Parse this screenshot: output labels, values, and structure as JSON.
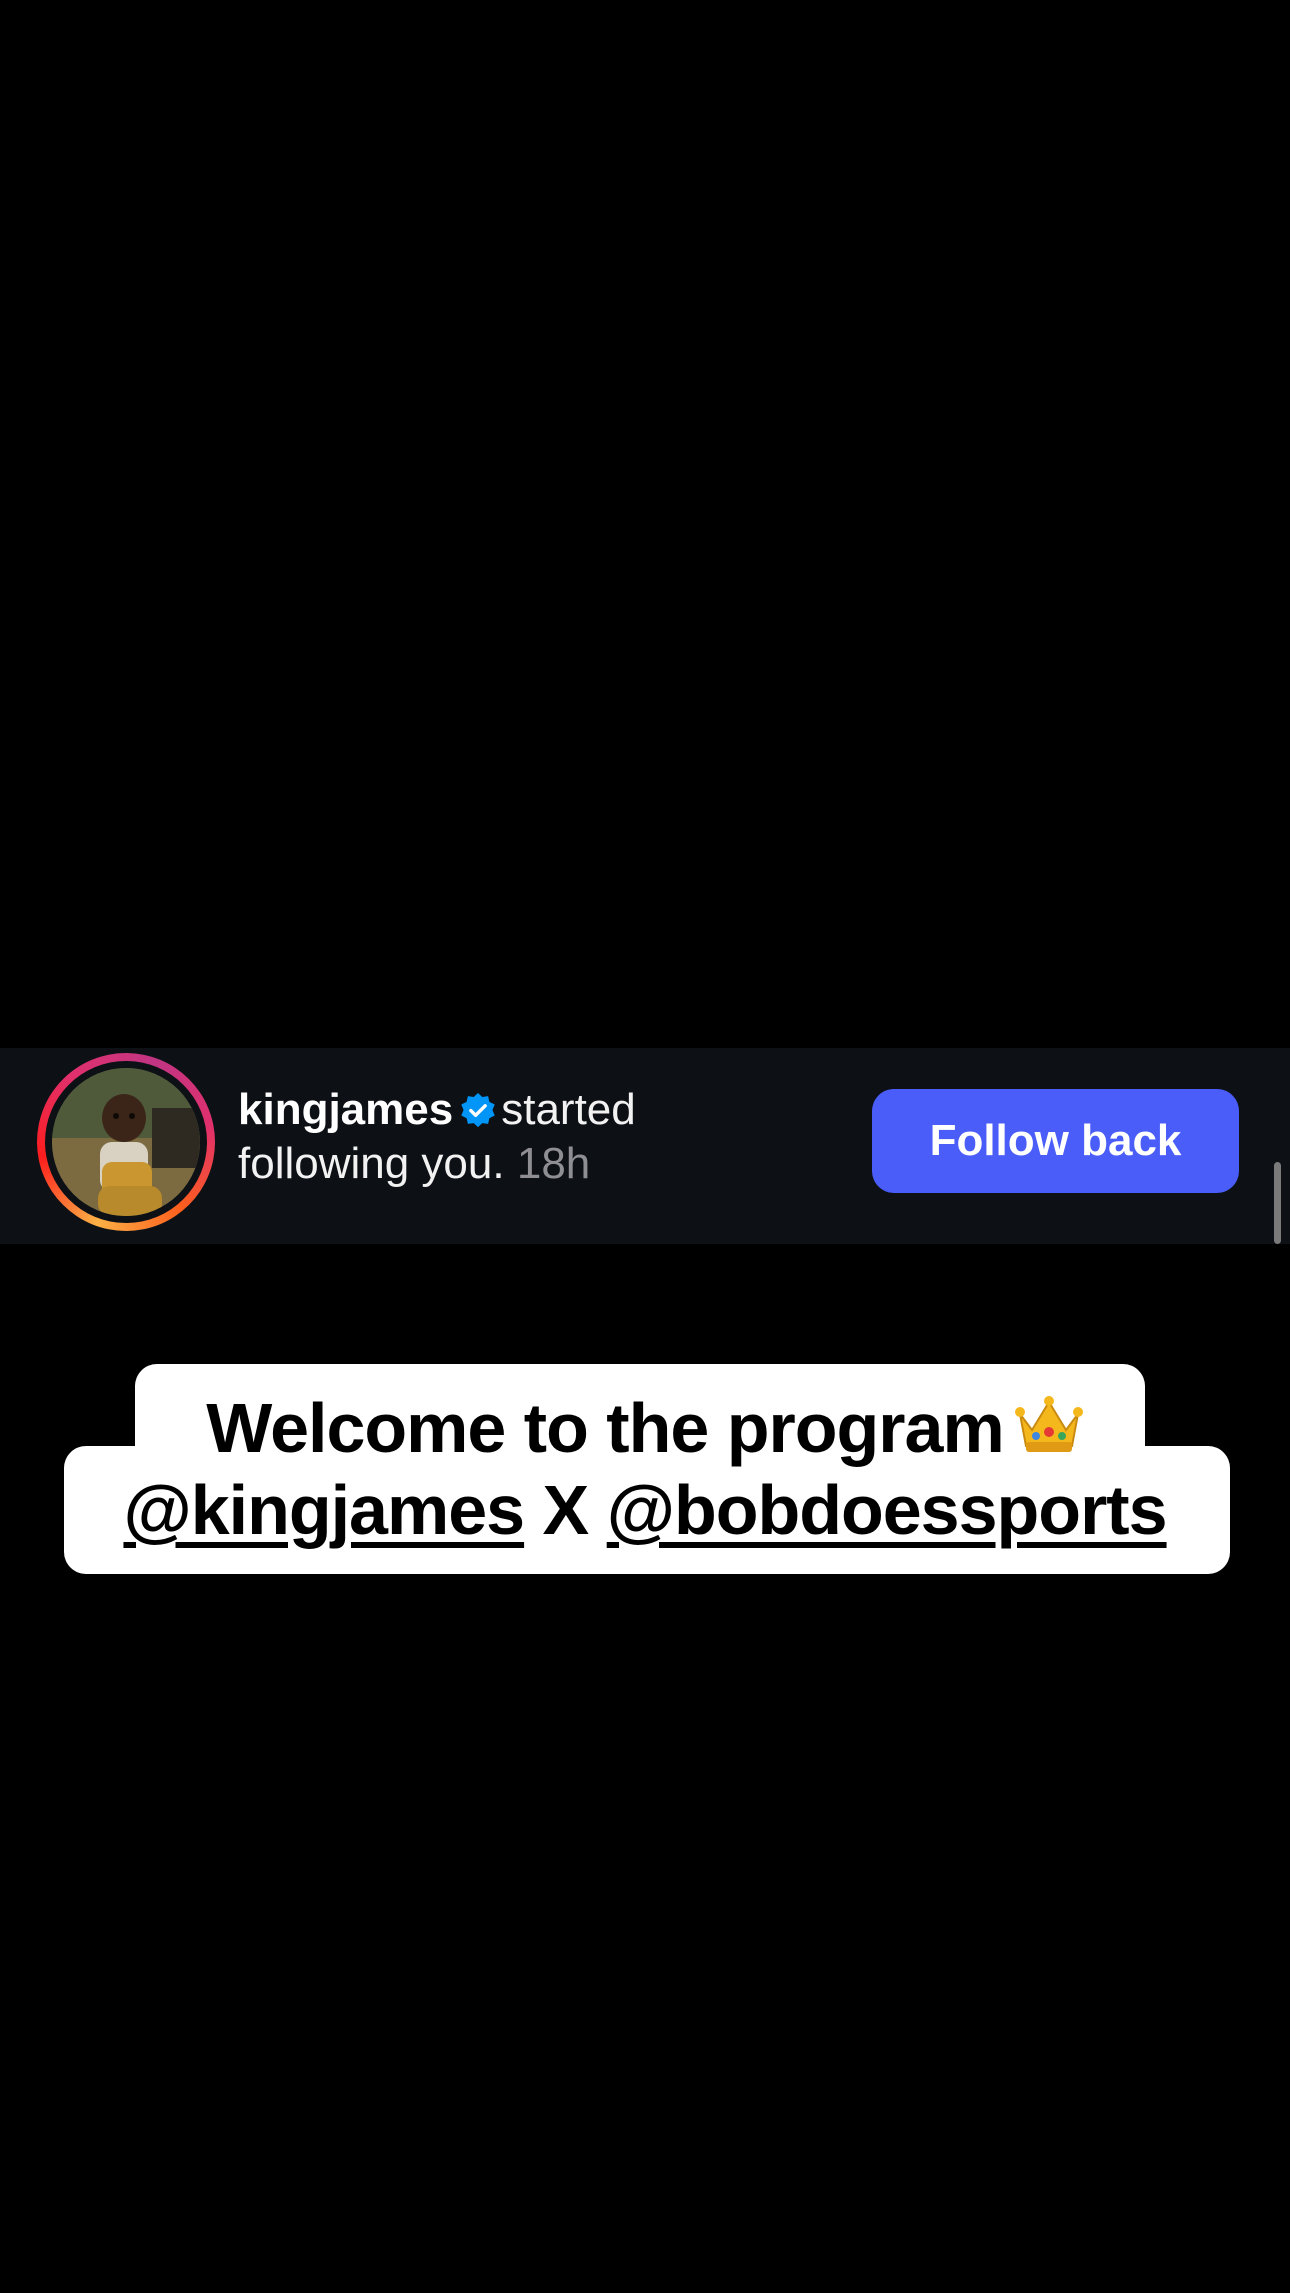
{
  "notification": {
    "username": "kingjames",
    "verified": true,
    "action_text": "started following you.",
    "action_part1": "started",
    "action_part2": "following you.",
    "time": "18h",
    "button_label": "Follow back",
    "button_color": "#4a5df9",
    "verified_color": "#0095f6",
    "avatar_icon": "profile-photo"
  },
  "caption": {
    "line1": "Welcome to the program",
    "line1_emoji": "crown-icon",
    "mention1": "@kingjames",
    "separator": "X",
    "mention2": "@bobdoessports"
  },
  "colors": {
    "background": "#000000",
    "notification_bg": "#0d1116",
    "caption_bg": "#ffffff"
  }
}
